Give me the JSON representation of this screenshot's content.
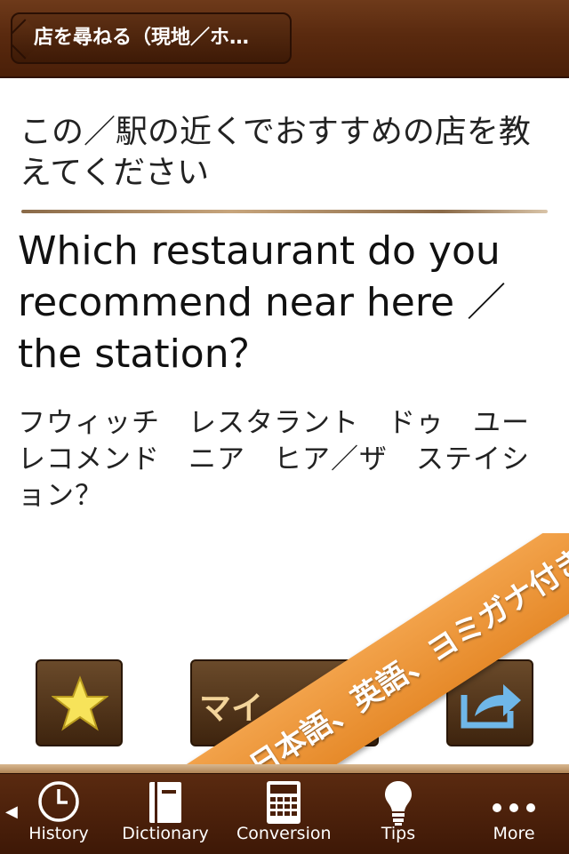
{
  "navbar": {
    "back_label": "店を尋ねる（現地／ホ…"
  },
  "phrase": {
    "japanese": "この／駅の近くでおすすめの店を教えてください",
    "english": "Which restaurant do you recommend near here ／ the station？",
    "katakana": "フウィッチ　レスタラント　ドゥ　ユー　レコメンド　ニア　ヒア／ザ　ステイション？"
  },
  "actions": {
    "middle_label": "マイ"
  },
  "promo": {
    "ribbon_text": "日本語、英語、ヨミガナ付き"
  },
  "tabbar": {
    "scroll_indicator": "◀",
    "tabs": [
      {
        "label": "History",
        "icon": "clock-icon"
      },
      {
        "label": "Dictionary",
        "icon": "book-icon"
      },
      {
        "label": "Conversion",
        "icon": "calculator-icon"
      },
      {
        "label": "Tips",
        "icon": "lightbulb-icon"
      },
      {
        "label": "More",
        "icon": "more-dots-icon"
      }
    ]
  },
  "colors": {
    "nav_brown": "#5a2a0f",
    "ribbon_orange": "#ee9a3e",
    "star_yellow": "#f7e35a",
    "share_blue": "#6fb7e8"
  }
}
